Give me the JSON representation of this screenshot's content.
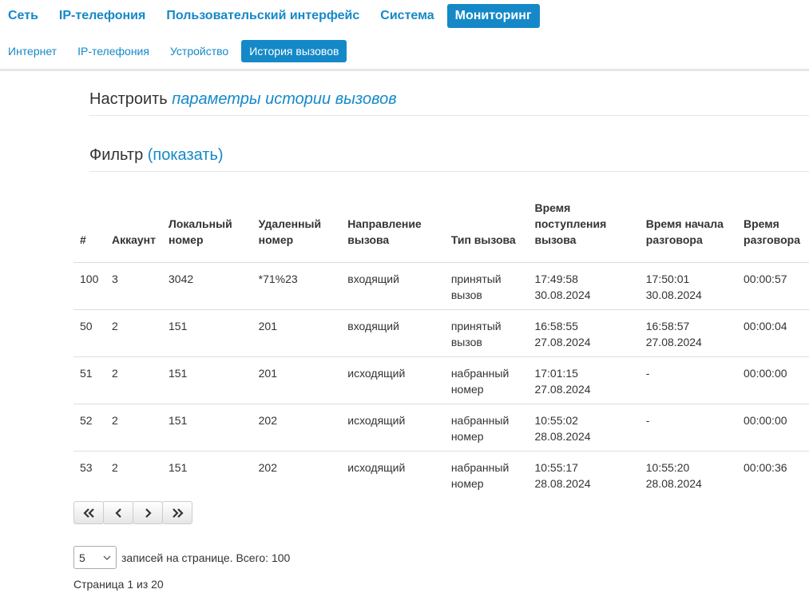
{
  "top_nav": [
    {
      "label": "Сеть",
      "active": false
    },
    {
      "label": "IP-телефония",
      "active": false
    },
    {
      "label": "Пользовательский интерфейс",
      "active": false
    },
    {
      "label": "Система",
      "active": false
    },
    {
      "label": "Мониторинг",
      "active": true
    }
  ],
  "sub_nav": [
    {
      "label": "Интернет",
      "active": false
    },
    {
      "label": "IP-телефония",
      "active": false
    },
    {
      "label": "Устройство",
      "active": false
    },
    {
      "label": "История вызовов",
      "active": true
    }
  ],
  "configure": {
    "prefix": "Настроить",
    "link": "параметры истории вызовов"
  },
  "filter": {
    "prefix": "Фильтр",
    "link": "(показать)"
  },
  "table": {
    "headers": [
      "#",
      "Аккаунт",
      "Локальный номер",
      "Удаленный номер",
      "Направление вызова",
      "Тип вызова",
      "Время поступления вызова",
      "Время начала разговора",
      "Время разговора"
    ],
    "rows": [
      [
        "100",
        "3",
        "3042",
        "*71%23",
        "входящий",
        "принятый вызов",
        "17:49:58 30.08.2024",
        "17:50:01 30.08.2024",
        "00:00:57"
      ],
      [
        "50",
        "2",
        "151",
        "201",
        "входящий",
        "принятый вызов",
        "16:58:55 27.08.2024",
        "16:58:57 27.08.2024",
        "00:00:04"
      ],
      [
        "51",
        "2",
        "151",
        "201",
        "исходящий",
        "набранный номер",
        "17:01:15 27.08.2024",
        "-",
        "00:00:00"
      ],
      [
        "52",
        "2",
        "151",
        "202",
        "исходящий",
        "набранный номер",
        "10:55:02 28.08.2024",
        "-",
        "00:00:00"
      ],
      [
        "53",
        "2",
        "151",
        "202",
        "исходящий",
        "набранный номер",
        "10:55:17 28.08.2024",
        "10:55:20 28.08.2024",
        "00:00:36"
      ]
    ]
  },
  "pager_buttons": [
    {
      "icon": "first-page-icon",
      "name": "first-page-button"
    },
    {
      "icon": "prev-page-icon",
      "name": "prev-page-button"
    },
    {
      "icon": "next-page-icon",
      "name": "next-page-button"
    },
    {
      "icon": "last-page-icon",
      "name": "last-page-button"
    }
  ],
  "page_size": {
    "value": "5",
    "label": "записей на странице. Всего: 100"
  },
  "page_info": "Страница 1 из 20"
}
